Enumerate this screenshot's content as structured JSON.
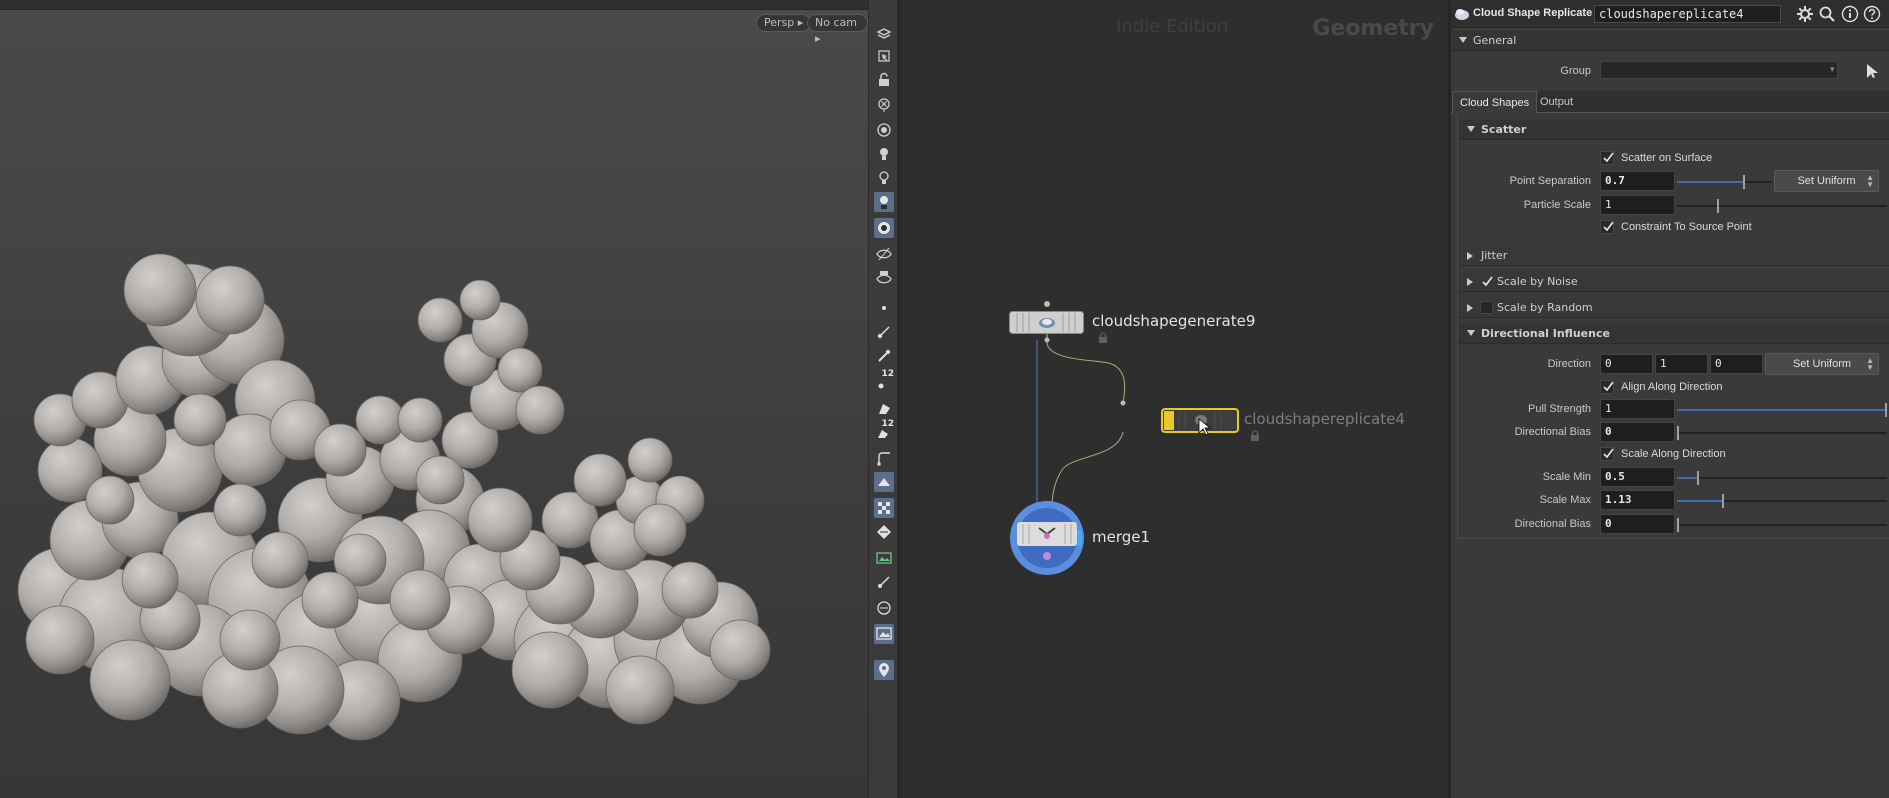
{
  "viewport": {
    "persp_label": "Persp",
    "cam_label": "No cam"
  },
  "toolbar": {
    "badges": [
      "12",
      "12"
    ]
  },
  "network": {
    "watermark": "Indie Edition",
    "context": "Geometry",
    "nodes": [
      {
        "name": "cloudshapegenerate9"
      },
      {
        "name": "cloudshapereplicate4"
      },
      {
        "name": "merge1"
      }
    ]
  },
  "params": {
    "node_type": "Cloud Shape Replicate",
    "node_name": "cloudshapereplicate4",
    "general_label": "General",
    "group_label": "Group",
    "group_value": "",
    "tabs": [
      {
        "label": "Cloud Shapes",
        "active": true
      },
      {
        "label": "Output",
        "active": false
      }
    ],
    "scatter": {
      "title": "Scatter",
      "scatter_on_surface": "Scatter on Surface",
      "point_separation_label": "Point Separation",
      "point_separation": "0.7",
      "set_uniform": "Set Uniform",
      "particle_scale_label": "Particle Scale",
      "particle_scale": "1",
      "constraint_label": "Constraint To Source Point"
    },
    "jitter_label": "Jitter",
    "scale_by_noise_label": "Scale by Noise",
    "scale_by_random_label": "Scale by Random",
    "directional": {
      "title": "Directional Influence",
      "direction_label": "Direction",
      "direction": [
        "0",
        "1",
        "0"
      ],
      "set_uniform": "Set Uniform",
      "align_label": "Align Along Direction",
      "pull_strength_label": "Pull Strength",
      "pull_strength": "1",
      "bias_label": "Directional Bias",
      "bias": "0",
      "scale_along_label": "Scale Along Direction",
      "scale_min_label": "Scale Min",
      "scale_min": "0.5",
      "scale_max_label": "Scale Max",
      "scale_max": "1.13",
      "bias2_label": "Directional Bias",
      "bias2": "0"
    }
  },
  "colors": {
    "accent_blue": "#3d6fb0",
    "node_selected": "#e8c82a",
    "toolbar_on": "#5b6f8a"
  }
}
